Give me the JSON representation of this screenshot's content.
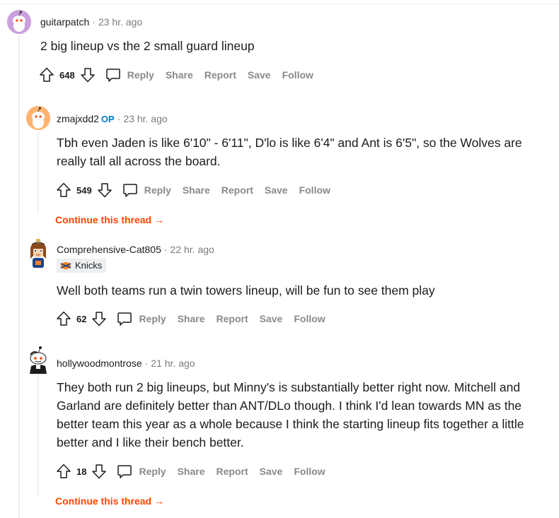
{
  "comments": [
    {
      "username": "guitarpatch",
      "time": "23 hr. ago",
      "body": "2 big lineup vs the 2 small guard lineup",
      "score": "648",
      "colors": {
        "avatar_bg": "#c9a0dc"
      }
    },
    {
      "username": "zmajxdd2",
      "op": "OP",
      "time": "23 hr. ago",
      "body": "Tbh even Jaden is like 6'10\" - 6'11\", D'lo is like 6'4\" and Ant is 6'5\", so the Wolves are really tall all across the board.",
      "score": "549",
      "continue": "Continue this thread",
      "colors": {
        "avatar_bg": "#ffb470"
      }
    },
    {
      "username": "Comprehensive-Cat805",
      "time": "22 hr. ago",
      "flair": "Knicks",
      "body": "Well both teams run a twin towers lineup, will be fun to see them play",
      "score": "62"
    },
    {
      "username": "hollywoodmontrose",
      "time": "21 hr. ago",
      "body": "They both run 2 big lineups, but Minny's is substantially better right now. Mitchell and Garland are definitely better than ANT/DLo though. I think I'd lean towards MN as the better team this year as a whole because I think the starting lineup fits together a little better and I like their bench better.",
      "score": "18",
      "continue": "Continue this thread"
    }
  ],
  "actions": {
    "reply": "Reply",
    "share": "Share",
    "report": "Report",
    "save": "Save",
    "follow": "Follow"
  },
  "dot": "·",
  "arrow": "→",
  "colors": {
    "accent": "#ff4500",
    "op": "#0079d3",
    "muted": "#878a8c"
  }
}
